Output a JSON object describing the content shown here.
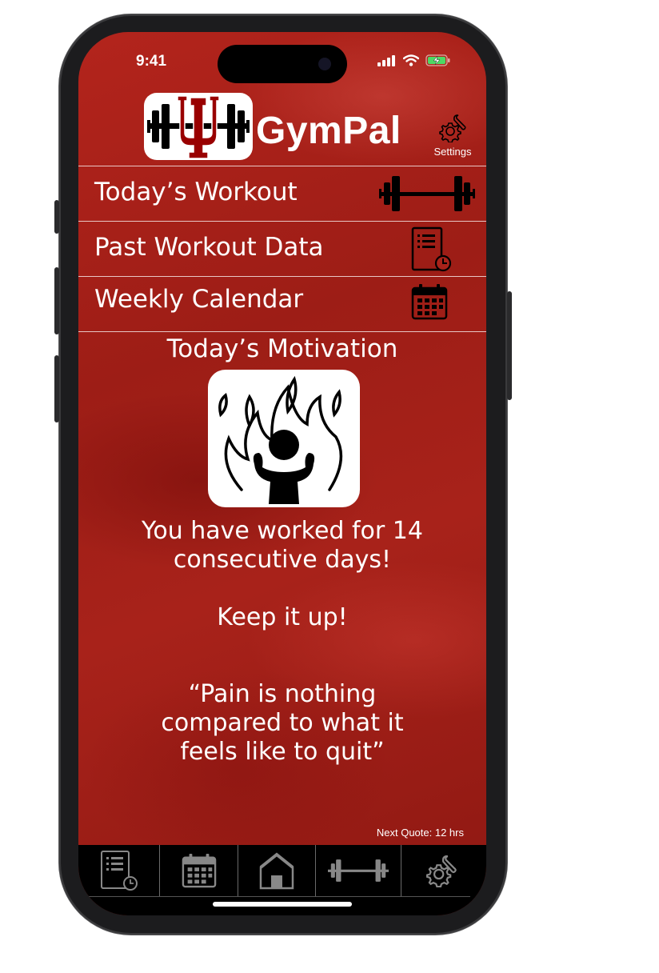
{
  "status_bar": {
    "time": "9:41"
  },
  "header": {
    "app_title": "GymPal",
    "settings_label": "Settings"
  },
  "menu": {
    "items": [
      {
        "label": "Today’s Workout",
        "icon": "dumbbell-icon"
      },
      {
        "label": "Past Workout Data",
        "icon": "workout-log-icon"
      },
      {
        "label": "Weekly Calendar",
        "icon": "calendar-icon"
      }
    ]
  },
  "motivation": {
    "title": "Today’s Motivation",
    "image_icon": "person-flame-icon",
    "streak_line1": "You have worked for 14",
    "streak_line2": "consecutive days!",
    "encouragement": "Keep it up!",
    "quote_line1": "“Pain is nothing",
    "quote_line2": "compared to what it",
    "quote_line3": "feels like to quit”",
    "next_quote": "Next Quote: 12 hrs"
  },
  "tab_bar": {
    "tabs": [
      {
        "icon": "workout-log-icon"
      },
      {
        "icon": "calendar-icon"
      },
      {
        "icon": "home-icon"
      },
      {
        "icon": "dumbbell-icon"
      },
      {
        "icon": "settings-icon"
      }
    ]
  },
  "colors": {
    "background": "#a8221a",
    "text": "#ffffff",
    "tab_bar": "#000000"
  }
}
